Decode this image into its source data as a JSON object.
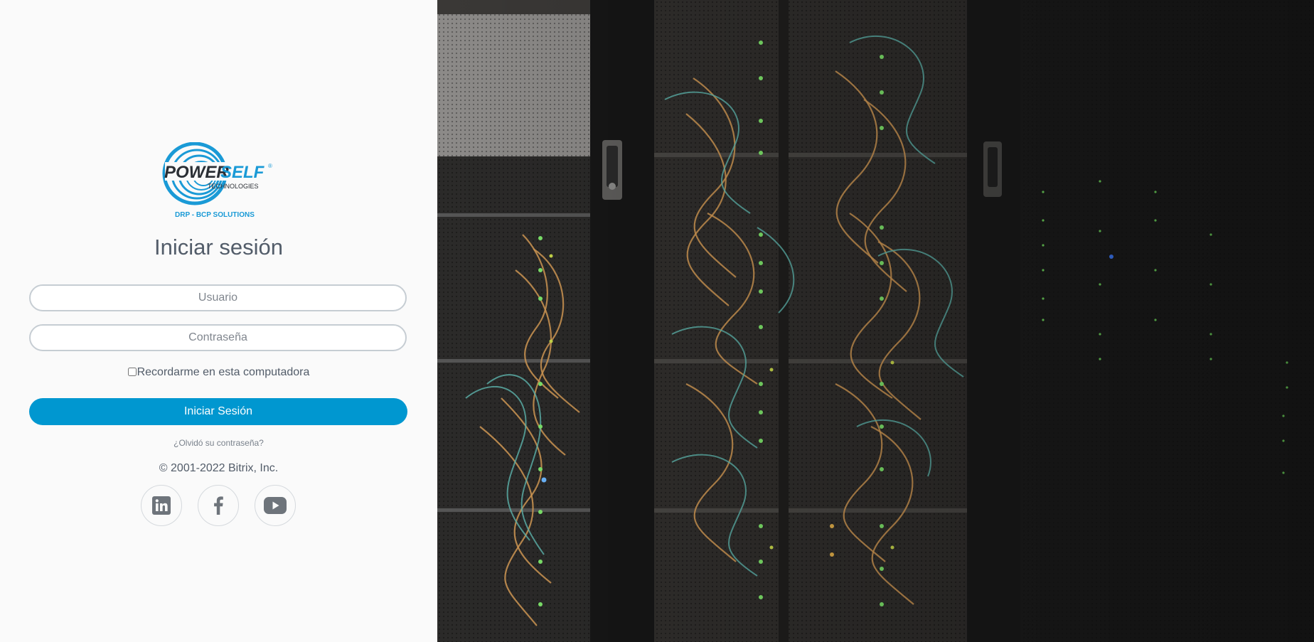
{
  "logo": {
    "brand_left": "POWER",
    "brand_right": "SELF",
    "registered": "®",
    "sub": "TECHNOLOGIES",
    "tagline": "DRP - BCP SOLUTIONS"
  },
  "login": {
    "title": "Iniciar sesión",
    "username_placeholder": "Usuario",
    "password_placeholder": "Contraseña",
    "remember_label": "Recordarme en esta computadora",
    "remember_checked": false,
    "submit_label": "Iniciar Sesión",
    "forgot_link": "¿Olvidó su contraseña?",
    "copyright": "© 2001-2022 Bitrix, Inc."
  },
  "social": [
    {
      "name": "linkedin",
      "icon": "linkedin-icon"
    },
    {
      "name": "facebook",
      "icon": "facebook-icon"
    },
    {
      "name": "youtube",
      "icon": "youtube-icon"
    }
  ],
  "colors": {
    "accent": "#0097d0",
    "text": "#525c69",
    "panel_bg": "#fafafa",
    "border": "#c6cdd3",
    "logo_blue": "#1a9ad6"
  },
  "background": {
    "image_subject": "server-racks-photo"
  }
}
